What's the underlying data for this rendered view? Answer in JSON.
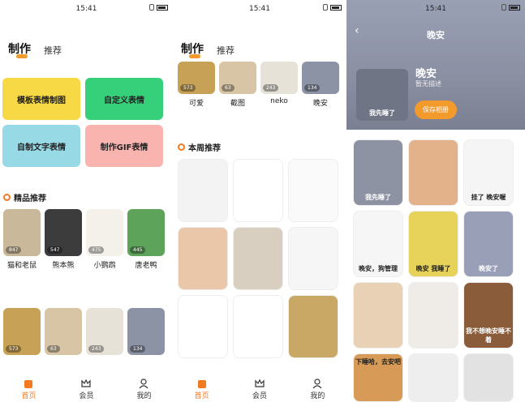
{
  "status": {
    "time": "15:41"
  },
  "tabs": {
    "active": "制作",
    "other": "推荐"
  },
  "feature_cards": [
    {
      "label": "模板表情制图",
      "color": "#f7d945"
    },
    {
      "label": "自定义表情",
      "color": "#37d07a"
    },
    {
      "label": "自制文字表情",
      "color": "#98d9e6"
    },
    {
      "label": "制作GIF表情",
      "color": "#f9b4b0"
    }
  ],
  "section_featured": "精品推荐",
  "featured": [
    {
      "name": "猫和老鼠",
      "count": "847"
    },
    {
      "name": "熊本熊",
      "count": "547"
    },
    {
      "name": "小鹦鹉",
      "count": "475"
    },
    {
      "name": "唐老鸭",
      "count": "445"
    }
  ],
  "row2_counts": [
    "573",
    "63",
    "243",
    "134"
  ],
  "p2_row": [
    {
      "name": "可爱",
      "count": "573"
    },
    {
      "name": "截图",
      "count": "63"
    },
    {
      "name": "neko",
      "count": "243"
    },
    {
      "name": "晚安",
      "count": "134"
    }
  ],
  "section_weekly": "本周推荐",
  "album": {
    "title": "晚安",
    "name": "晚安",
    "desc": "暂无描述",
    "save": "保存相册",
    "cover_caption": "我先睡了"
  },
  "album_labels": {
    "c1": "我先睡了",
    "c3": "挂了 晚安喔",
    "c4": "晚安，狗管理",
    "c5": "晚安 我睡了",
    "c6": "晚安了",
    "c9": "我不想晚安睡不着",
    "c10": "下睡哈，去安吧"
  },
  "nav": [
    {
      "label": "首页",
      "icon": "home-icon"
    },
    {
      "label": "会员",
      "icon": "crown-icon"
    },
    {
      "label": "我的",
      "icon": "user-icon"
    }
  ]
}
